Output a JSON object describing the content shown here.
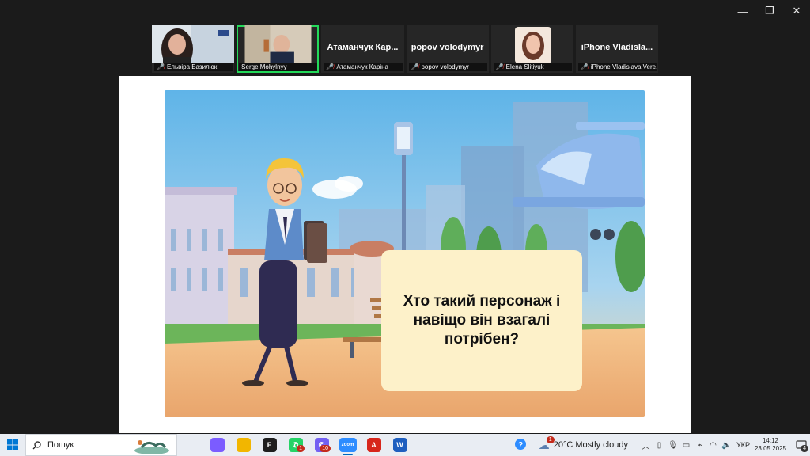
{
  "window": {
    "controls": [
      "—",
      "❐",
      "✕"
    ]
  },
  "participants": [
    {
      "caption": "Ельвіра Базилюк",
      "big_name": "",
      "has_video": true,
      "active": false
    },
    {
      "caption": "Serge Mohylnyy",
      "big_name": "",
      "has_video": true,
      "active": true
    },
    {
      "caption": "Атаманчук Каріна",
      "big_name": "Атаманчук Кар...",
      "has_video": false,
      "active": false
    },
    {
      "caption": "popov volodymyr",
      "big_name": "popov volodymyr",
      "has_video": false,
      "active": false
    },
    {
      "caption": "Elena Slitiyuk",
      "big_name": "",
      "has_video": true,
      "active": false
    },
    {
      "caption": "iPhone Vladislava Vere...",
      "big_name": "iPhone Vladisla...",
      "has_video": false,
      "active": false
    }
  ],
  "slide": {
    "question": "Хто такий персонаж і навіщо він взагалі потрібен?"
  },
  "taskbar": {
    "search_placeholder": "Пошук",
    "apps": [
      {
        "name": "copilot",
        "color": "#7b5cff",
        "glyph": "",
        "badge": "",
        "active": false
      },
      {
        "name": "file-explorer",
        "color": "#f2b600",
        "glyph": "",
        "badge": "",
        "active": false
      },
      {
        "name": "figma",
        "color": "#1e1e1e",
        "glyph": "F",
        "badge": "",
        "active": false
      },
      {
        "name": "whatsapp",
        "color": "#25d366",
        "glyph": "✆",
        "badge": "1",
        "active": false
      },
      {
        "name": "viber",
        "color": "#7360f2",
        "glyph": "✆",
        "badge": "10",
        "active": false
      },
      {
        "name": "zoom",
        "color": "#2d8cff",
        "glyph": "zoom",
        "badge": "",
        "active": true
      },
      {
        "name": "acrobat",
        "color": "#d7261b",
        "glyph": "A",
        "badge": "",
        "active": false
      },
      {
        "name": "word",
        "color": "#1f5fbf",
        "glyph": "W",
        "badge": "",
        "active": false
      }
    ],
    "weather_text": "20°C  Mostly cloudy",
    "weather_badge": "1",
    "language": "УКР",
    "time": "14:12",
    "date": "23.05.2025",
    "notification_count": "4"
  }
}
